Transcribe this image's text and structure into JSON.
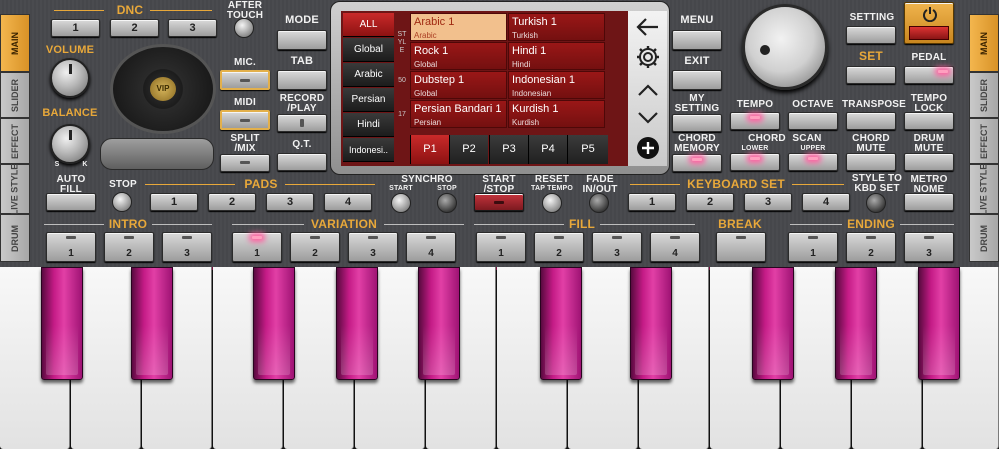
{
  "side_left": [
    "MAIN",
    "SLIDER",
    "EFFECT",
    "LIVE STYLE",
    "DRUM"
  ],
  "side_right": [
    "MAIN",
    "SLIDER",
    "EFFECT",
    "LIVE STYLE",
    "DRUM"
  ],
  "dnc": {
    "title": "DNC",
    "buttons": [
      "1",
      "2",
      "3"
    ],
    "after_touch": "AFTER TOUCH"
  },
  "volume": "VOLUME",
  "balance": "BALANCE",
  "balance_s": "S",
  "balance_k": "K",
  "turntable_label": "VIP",
  "mic": "MIC.",
  "midi": "MIDI",
  "split_mix": "SPLIT /MIX",
  "mode": "MODE",
  "tab": "TAB",
  "record_play": "RECORD /PLAY",
  "qt": "Q.T.",
  "screen": {
    "filters": [
      "ALL",
      "Global",
      "Arabic",
      "Persian",
      "Hindi",
      "Indonesi.."
    ],
    "side_text": "STYLE",
    "side_nums": [
      "50",
      "17"
    ],
    "styles": [
      {
        "name": "Arabic 1",
        "cat": "Arabic"
      },
      {
        "name": "Turkish 1",
        "cat": "Turkish"
      },
      {
        "name": "Rock 1",
        "cat": "Global"
      },
      {
        "name": "Hindi 1",
        "cat": "Hindi"
      },
      {
        "name": "Dubstep 1",
        "cat": "Global"
      },
      {
        "name": "Indonesian 1",
        "cat": "Indonesian"
      },
      {
        "name": "Persian Bandari 1",
        "cat": "Persian"
      },
      {
        "name": "Kurdish 1",
        "cat": "Kurdish"
      }
    ],
    "pages": [
      "P1",
      "P2",
      "P3",
      "P4",
      "P5"
    ],
    "back_icon": "arrow-left-icon",
    "settings_icon": "gear-icon",
    "up_icon": "chevron-up-icon",
    "down_icon": "chevron-down-icon",
    "add_icon": "plus-icon"
  },
  "menu": "MENU",
  "exit": "EXIT",
  "my_setting": "MY SETTING",
  "chord_memory": "CHORD MEMORY",
  "setting": "SETTING",
  "set": "SET",
  "pedal": "PEDAL",
  "power_icon": "power-icon",
  "top_right_labels": {
    "tempo": "TEMPO",
    "octave": "OCTAVE",
    "transpose": "TRANSPOSE",
    "tempo_lock": "TEMPO LOCK",
    "chord_lower": "CHORD",
    "lower": "LOWER",
    "scan_upper": "SCAN",
    "upper": "UPPER",
    "chord_mute": "CHORD MUTE",
    "drum_mute": "DRUM MUTE"
  },
  "row2": {
    "auto_fill": "AUTO FILL",
    "stop": "STOP",
    "pads": "PADS",
    "pads_buttons": [
      "1",
      "2",
      "3",
      "4"
    ],
    "synchro": "SYNCHRO",
    "sync_start": "START",
    "sync_stop": "STOP",
    "start_stop": "START /STOP",
    "reset": "RESET",
    "tap_tempo": "TAP TEMPO",
    "fade": "FADE IN/OUT",
    "keyboard_set": "KEYBOARD SET",
    "kbd_buttons": [
      "1",
      "2",
      "3",
      "4"
    ],
    "style_to_kbd": "STYLE TO KBD SET",
    "metronome": "METRO NOME"
  },
  "row3": {
    "intro": "INTRO",
    "variation": "VARIATION",
    "fill": "FILL",
    "break": "BREAK",
    "ending": "ENDING",
    "intro_buttons": [
      "1",
      "2",
      "3"
    ],
    "variation_buttons": [
      "1",
      "2",
      "3",
      "4"
    ],
    "fill_buttons": [
      "1",
      "2",
      "3",
      "4"
    ],
    "ending_buttons": [
      "1",
      "2",
      "3"
    ]
  },
  "colors": {
    "accent": "#e8a83a",
    "screen_red": "#7d1212",
    "key_pink": "#d32e96"
  }
}
